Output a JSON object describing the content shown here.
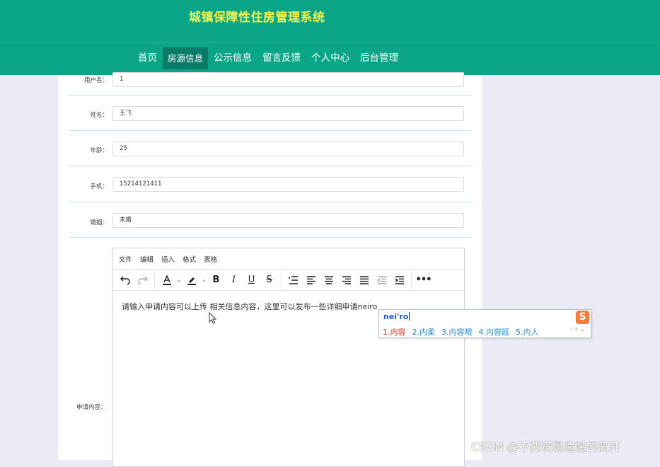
{
  "header": {
    "title": "城镇保障性住房管理系统",
    "nav": [
      {
        "label": "首页",
        "active": false
      },
      {
        "label": "房源信息",
        "active": true
      },
      {
        "label": "公示信息",
        "active": false
      },
      {
        "label": "留言反馈",
        "active": false
      },
      {
        "label": "个人中心",
        "active": false
      },
      {
        "label": "后台管理",
        "active": false
      }
    ]
  },
  "form": {
    "fields": [
      {
        "label": "用户名：",
        "value": "1"
      },
      {
        "label": "姓名：",
        "value": "王飞"
      },
      {
        "label": "年龄：",
        "value": "25"
      },
      {
        "label": "手机：",
        "value": "15214121411"
      },
      {
        "label": "婚姻：",
        "value": "未婚"
      }
    ],
    "content_label": "申请内容："
  },
  "editor": {
    "menus": [
      "文件",
      "编辑",
      "插入",
      "格式",
      "表格"
    ],
    "text": "请输入申请内容可以上传 相关信息内容，这里可以发布一些详细申请neiro"
  },
  "ime": {
    "composition": "nei'ro",
    "candidates": [
      "1.内容",
      "2.内柔",
      "3.内容哦",
      "4.内容瓯",
      "5.内人"
    ],
    "logo": "S"
  },
  "watermark": "CSDN @不要满是遗憾的离开"
}
